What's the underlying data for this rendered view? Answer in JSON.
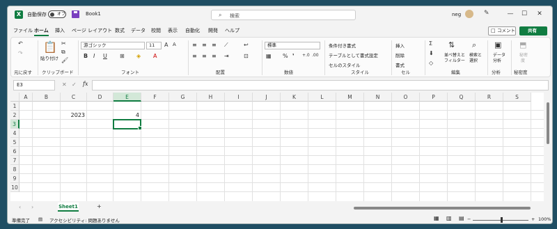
{
  "titlebar": {
    "autosave_label": "自動保存",
    "autosave_state": "オフ",
    "book_name": "Book1",
    "search_placeholder": "検索",
    "user": "neg"
  },
  "menu": [
    "ファイル",
    "ホーム",
    "挿入",
    "ページ レイアウト",
    "数式",
    "データ",
    "校閲",
    "表示",
    "自動化",
    "開発",
    "ヘルプ"
  ],
  "actions": {
    "comment": "コメント",
    "share": "共有"
  },
  "ribbon": {
    "groups": [
      "元に戻す",
      "クリップボード",
      "フォント",
      "配置",
      "数値",
      "スタイル",
      "セル",
      "編集",
      "分析",
      "秘密度"
    ],
    "paste": "貼り付け",
    "font_name": "游ゴシック",
    "font_size": "11",
    "number_format": "標準",
    "styles": [
      "条件付き書式",
      "テーブルとして書式設定",
      "セルのスタイル"
    ],
    "cells": [
      "挿入",
      "削除",
      "書式"
    ],
    "edit": [
      "並べ替えと",
      "フィルター",
      "検索と",
      "選択"
    ],
    "analysis": [
      "データ",
      "分析"
    ],
    "sensitivity": [
      "秘密",
      "度"
    ],
    "bold": "B",
    "italic": "I",
    "underline": "U"
  },
  "namebox": "E3",
  "fx": "fx",
  "columns": [
    "A",
    "B",
    "C",
    "D",
    "E",
    "F",
    "G",
    "H",
    "I",
    "J",
    "K",
    "L",
    "M",
    "N",
    "O",
    "P",
    "Q",
    "R",
    "S"
  ],
  "rows": [
    "1",
    "2",
    "3",
    "4",
    "5",
    "6",
    "7",
    "8",
    "9",
    "10"
  ],
  "cells": {
    "C2": "2023",
    "E2": "4"
  },
  "sheet": "Sheet1",
  "status": {
    "ready": "準備完了",
    "accessibility": "アクセシビリティ: 問題ありません",
    "zoom": "100%"
  }
}
